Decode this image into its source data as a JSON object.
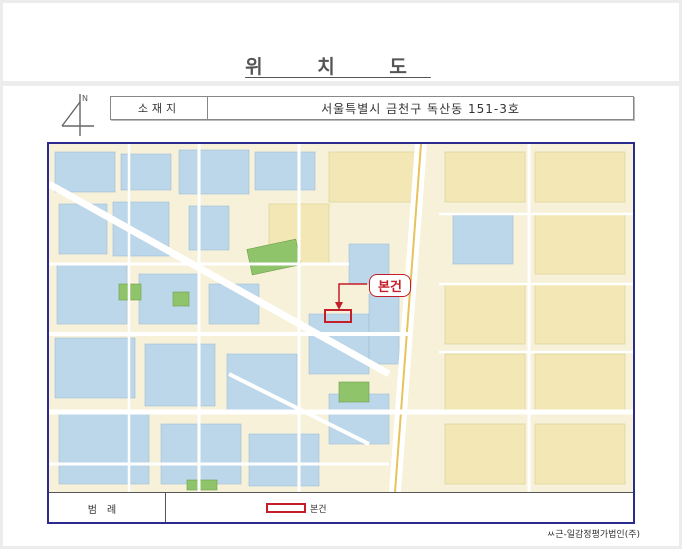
{
  "header": {
    "title": "위 치 도"
  },
  "address": {
    "label": "소재지",
    "value": "서울특별시 금천구 독산동 151-3호"
  },
  "map": {
    "callout": "본건",
    "north_letter": "N"
  },
  "legend": {
    "label": "범례",
    "item": "본건"
  },
  "footer": {
    "company": "ㅆ근-일감정평가법인(주)"
  },
  "colors": {
    "frame": "#2b2b8f",
    "highlight": "#c41e2a",
    "parcel_blue": "#bcd6ea",
    "parcel_yellow": "#f3e8b5",
    "park_green": "#8fc46a"
  }
}
